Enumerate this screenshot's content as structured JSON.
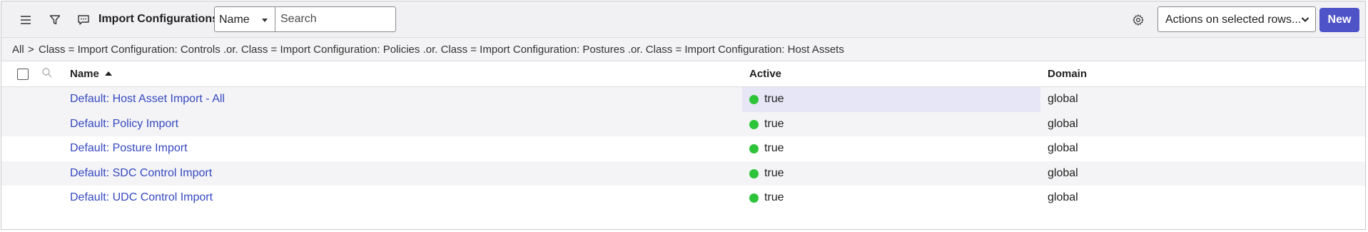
{
  "header": {
    "title": "Import Configurations",
    "search_field_selected": "Name",
    "search_placeholder": "Search",
    "actions_label": "Actions on selected rows...",
    "new_label": "New",
    "icons": [
      "menu-icon",
      "filter-icon",
      "comment-icon",
      "gear-icon",
      "chevron-down-icon"
    ]
  },
  "breadcrumb": {
    "all": "All",
    "separator": ">",
    "filter": "Class = Import Configuration: Controls .or. Class = Import Configuration: Policies .or. Class = Import Configuration: Postures .or. Class = Import Configuration: Host Assets"
  },
  "table": {
    "columns": {
      "name": "Name",
      "active": "Active",
      "domain": "Domain"
    },
    "sort": {
      "column": "Name",
      "direction": "ascending"
    },
    "rows": [
      {
        "name": "Default: Host Asset Import - All",
        "active": "true",
        "domain": "global"
      },
      {
        "name": "Default: Policy Import",
        "active": "true",
        "domain": "global"
      },
      {
        "name": "Default: Posture Import",
        "active": "true",
        "domain": "global"
      },
      {
        "name": "Default: SDC Control Import",
        "active": "true",
        "domain": "global"
      },
      {
        "name": "Default: UDC Control Import",
        "active": "true",
        "domain": "global"
      }
    ]
  },
  "colors": {
    "accent": "#4e54c8",
    "link": "#3548c0",
    "active_dot": "#2ec43a",
    "highlight_cell": "#e6e6f6"
  }
}
